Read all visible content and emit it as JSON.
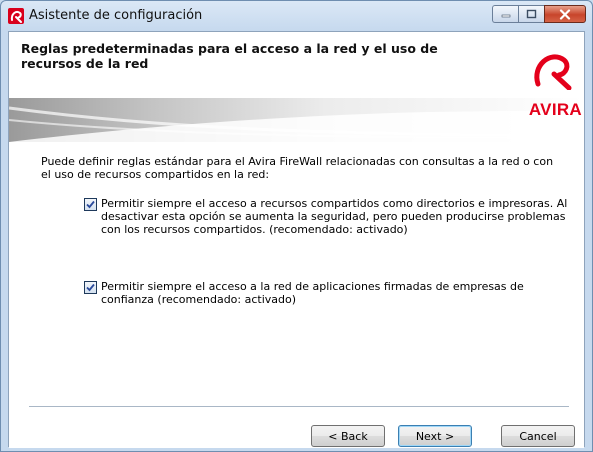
{
  "window": {
    "title": "Asistente de configuración",
    "icon": "avira-umbrella-icon",
    "caption_buttons": [
      "minimize-icon",
      "maximize-icon",
      "close-icon"
    ]
  },
  "header": {
    "title": "Reglas predeterminadas para el acceso a la red y el uso de recursos de la red",
    "logo_text": "AVIRA",
    "brand_color": "#e4001b"
  },
  "content": {
    "intro": "Puede definir reglas estándar para el Avira FireWall relacionadas con consultas a la red o con el uso de recursos compartidos en la red:",
    "options": [
      {
        "checked": true,
        "text": "Permitir siempre el acceso a recursos compartidos como directorios e impresoras. Al desactivar esta opción se aumenta la seguridad, pero pueden producirse problemas con los recursos compartidos. (recomendado: activado)"
      },
      {
        "checked": true,
        "text": "Permitir siempre el acceso a la red de aplicaciones firmadas de empresas de confianza (recomendado: activado)"
      }
    ]
  },
  "buttons": {
    "back": "< Back",
    "next": "Next >",
    "cancel": "Cancel"
  }
}
